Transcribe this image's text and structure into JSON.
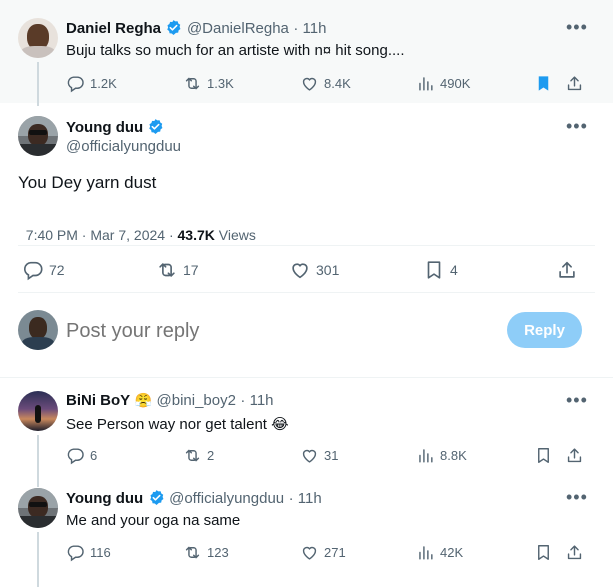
{
  "parent_tweet": {
    "author_name": "Daniel Regha",
    "author_handle": "@DanielRegha",
    "time": "· 11h",
    "text": "Buju talks so much for an artiste with n¤ hit song....",
    "replies": "1.2K",
    "retweets": "1.3K",
    "likes": "8.4K",
    "views": "490K"
  },
  "main_tweet": {
    "author_name": "Young duu",
    "author_handle": "@officialyungduu",
    "text": "You Dey yarn dust",
    "time_date": "7:40 PM · Mar 7, 2024 · ",
    "views_count": "43.7K",
    "views_label": " Views",
    "replies": "72",
    "retweets": "17",
    "likes": "301",
    "bookmarks": "4"
  },
  "reply_box": {
    "placeholder": "Post your reply",
    "button_label": "Reply"
  },
  "replies": [
    {
      "author_name": "BiNi BoY",
      "author_emoji": "😤",
      "author_handle": "@bini_boy2",
      "time": "· 11h",
      "text": "See Person way nor get talent 😂",
      "replies": "6",
      "retweets": "2",
      "likes": "31",
      "views": "8.8K"
    },
    {
      "author_name": "Young duu",
      "author_handle": "@officialyungduu",
      "time": "· 11h",
      "text": "Me and your oga na same",
      "replies": "116",
      "retweets": "123",
      "likes": "271",
      "views": "42K"
    }
  ],
  "colors": {
    "accent": "#1d9bf0",
    "reply_button_disabled": "#8ecdf8",
    "secondary_text": "#536471"
  }
}
